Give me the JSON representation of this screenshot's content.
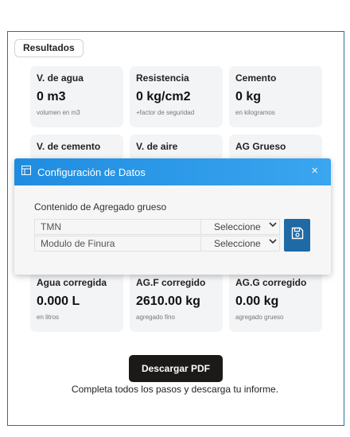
{
  "results_tab": "Resultados",
  "cards_top": [
    {
      "label": "V. de agua",
      "value": "0 m3",
      "note": "volumen en m3"
    },
    {
      "label": "Resistencia",
      "value": "0 kg/cm2",
      "note": "+factor de seguridad"
    },
    {
      "label": "Cemento",
      "value": "0 kg",
      "note": "en kilogramos"
    }
  ],
  "cards_mid": [
    {
      "label": "V. de cemento"
    },
    {
      "label": "V. de aire"
    },
    {
      "label": "AG Grueso"
    }
  ],
  "cards_bottom": [
    {
      "label": "Agua corregida",
      "value": "0.000 L",
      "note": "en litros"
    },
    {
      "label": "AG.F corregido",
      "value": "2610.00 kg",
      "note": "agregado fino"
    },
    {
      "label": "AG.G corregido",
      "value": "0.00 kg",
      "note": "agregado grueso"
    }
  ],
  "modal": {
    "title": "Configuración de Datos",
    "close_icon": "×",
    "section_title": "Contenido de Agregado grueso",
    "rows": [
      {
        "label": "TMN",
        "select": "Seleccione"
      },
      {
        "label": "Modulo de Finura",
        "select": "Seleccione"
      }
    ]
  },
  "download_button": "Descargar PDF",
  "hint": "Completa todos los pasos y descarga tu informe.",
  "colors": {
    "accent": "#1f8ce0",
    "save": "#1f6aa5",
    "frame": "#2f6f96",
    "dark_button": "#1c1919"
  }
}
